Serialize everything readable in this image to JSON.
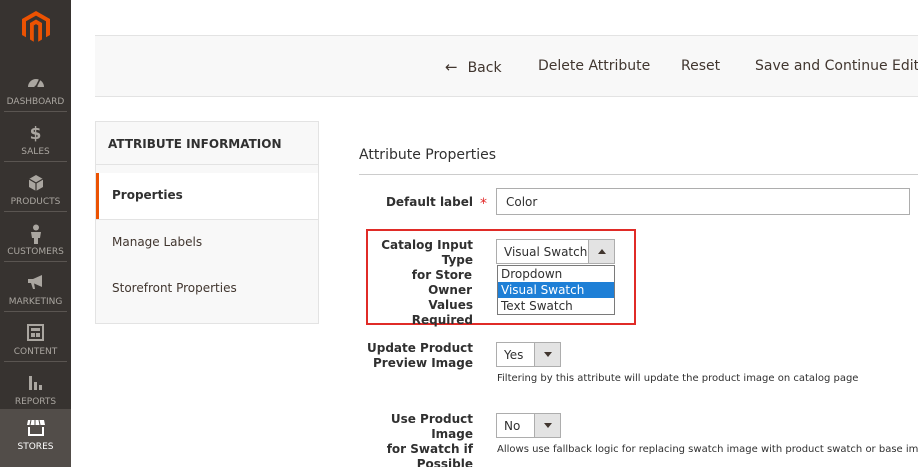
{
  "nav": {
    "items": [
      {
        "label": "DASHBOARD",
        "icon": "gauge-icon"
      },
      {
        "label": "SALES",
        "icon": "dollar-icon"
      },
      {
        "label": "PRODUCTS",
        "icon": "cube-icon"
      },
      {
        "label": "CUSTOMERS",
        "icon": "person-icon"
      },
      {
        "label": "MARKETING",
        "icon": "megaphone-icon"
      },
      {
        "label": "CONTENT",
        "icon": "layout-icon"
      },
      {
        "label": "REPORTS",
        "icon": "bar-chart-icon"
      },
      {
        "label": "STORES",
        "icon": "store-icon"
      }
    ],
    "active": "STORES",
    "colors": {
      "background": "#373330",
      "active": "#524d49",
      "logo": "#eb5202"
    }
  },
  "actions": {
    "back": "Back",
    "delete": "Delete Attribute",
    "reset": "Reset",
    "save": "Save and Continue Edit"
  },
  "tabs": {
    "title": "ATTRIBUTE INFORMATION",
    "items": [
      "Properties",
      "Manage Labels",
      "Storefront Properties"
    ],
    "active": "Properties"
  },
  "section": {
    "title": "Attribute Properties"
  },
  "fields": {
    "default_label": {
      "label": "Default label",
      "required_mark": "*",
      "value": "Color"
    },
    "catalog_input": {
      "label_line1": "Catalog Input Type",
      "label_line2": "for Store Owner",
      "value": "Visual Swatch",
      "options": [
        "Dropdown",
        "Visual Swatch",
        "Text Swatch"
      ],
      "selected": "Visual Swatch"
    },
    "values_required": {
      "label": "Values Required"
    },
    "update_preview": {
      "label_line1": "Update Product",
      "label_line2": "Preview Image",
      "value": "Yes",
      "note": "Filtering by this attribute will update the product image on catalog page"
    },
    "use_product_image": {
      "label_line1": "Use Product Image",
      "label_line2": "for Swatch if",
      "label_line3": "Possible",
      "value": "No",
      "note": "Allows use fallback logic for replacing swatch image with product swatch or base image"
    }
  },
  "colors": {
    "accent": "#eb5202",
    "highlight_border": "#e02b27",
    "selected_option": "#1e7fd6"
  }
}
